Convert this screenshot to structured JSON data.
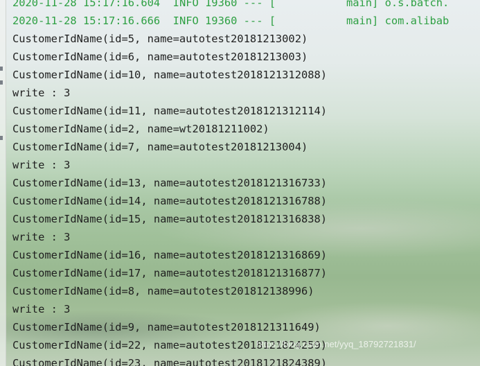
{
  "console": {
    "log_lines": [
      {
        "timestamp": "2020-11-28 15:17:16.604",
        "level": "INFO",
        "pid": "19360",
        "sep": "---",
        "bracket": "[",
        "thread": "main]",
        "logger": "o.s.batch."
      },
      {
        "timestamp": "2020-11-28 15:17:16.666",
        "level": "INFO",
        "pid": "19360",
        "sep": "---",
        "bracket": "[",
        "thread": "main]",
        "logger": "com.alibab"
      }
    ],
    "output_lines": [
      "CustomerIdName(id=5, name=autotest20181213002)",
      "CustomerIdName(id=6, name=autotest20181213003)",
      "CustomerIdName(id=10, name=autotest2018121312088)",
      "write : 3",
      "CustomerIdName(id=11, name=autotest2018121312114)",
      "CustomerIdName(id=2, name=wt20181211002)",
      "CustomerIdName(id=7, name=autotest20181213004)",
      "write : 3",
      "CustomerIdName(id=13, name=autotest2018121316733)",
      "CustomerIdName(id=14, name=autotest2018121316788)",
      "CustomerIdName(id=15, name=autotest2018121316838)",
      "write : 3",
      "CustomerIdName(id=16, name=autotest2018121316869)",
      "CustomerIdName(id=17, name=autotest2018121316877)",
      "CustomerIdName(id=8, name=autotest201812138996)",
      "write : 3",
      "CustomerIdName(id=9, name=autotest2018121311649)",
      "CustomerIdName(id=22, name=autotest2018121824259)",
      "CustomerIdName(id=23, name=autotest2018121824389)"
    ],
    "watermark": "https://blog.csdn.net/yyq_18792721831/"
  },
  "colors": {
    "log_text": "#2ea043",
    "output_text": "#1f1f1f"
  }
}
